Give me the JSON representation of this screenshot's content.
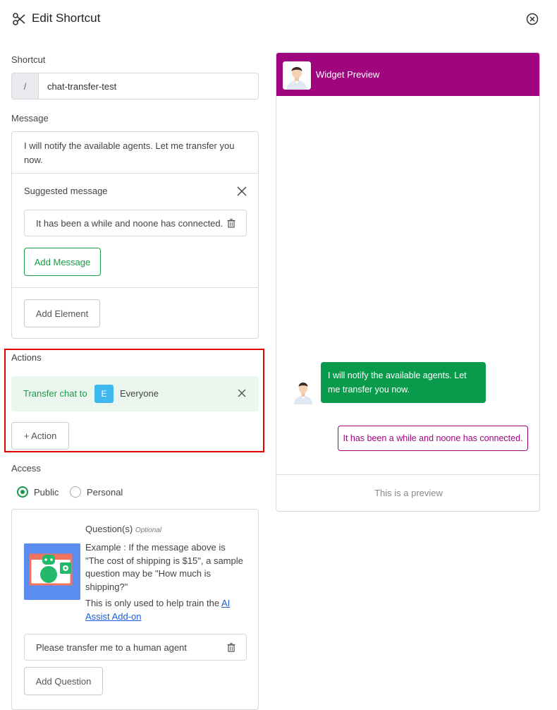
{
  "header": {
    "icon": "scissors-icon",
    "title": "Edit Shortcut",
    "close_icon": "close-circle-icon"
  },
  "shortcut": {
    "label": "Shortcut",
    "prefix": "/",
    "value": "chat-transfer-test"
  },
  "message": {
    "label": "Message",
    "text": "I will notify the available agents. Let me transfer you now.",
    "suggested_title": "Suggested message",
    "suggested_value": "It has been a while and noone has connected.",
    "add_message_label": "Add Message",
    "add_element_label": "Add Element"
  },
  "actions": {
    "label": "Actions",
    "action_text": "Transfer chat to",
    "badge": "E",
    "target": "Everyone",
    "add_action_label": "+ Action",
    "highlight_color": "#e60000"
  },
  "access": {
    "label": "Access",
    "options": [
      "Public",
      "Personal"
    ],
    "selected": "Public"
  },
  "questions": {
    "title": "Question(s)",
    "optional": "Optional",
    "example": "Example : If the message above is \"The cost of shipping is $15\", a sample question may be \"How much is shipping?\"",
    "train_prefix": "This is only used to help train the ",
    "train_link": "AI Assist Add-on",
    "question_value": "Please transfer me to a human agent",
    "add_question_label": "Add Question"
  },
  "preview": {
    "title": "Widget Preview",
    "agent_message": "I will notify the available agents. Let me transfer you now.",
    "suggested_message": "It has been a while and noone has connected.",
    "footer": "This is a preview",
    "header_color": "#a1047f",
    "agent_bubble_color": "#0a9a4b"
  },
  "colors": {
    "green": "#1a9a48",
    "badge_blue": "#3fb8f0"
  }
}
